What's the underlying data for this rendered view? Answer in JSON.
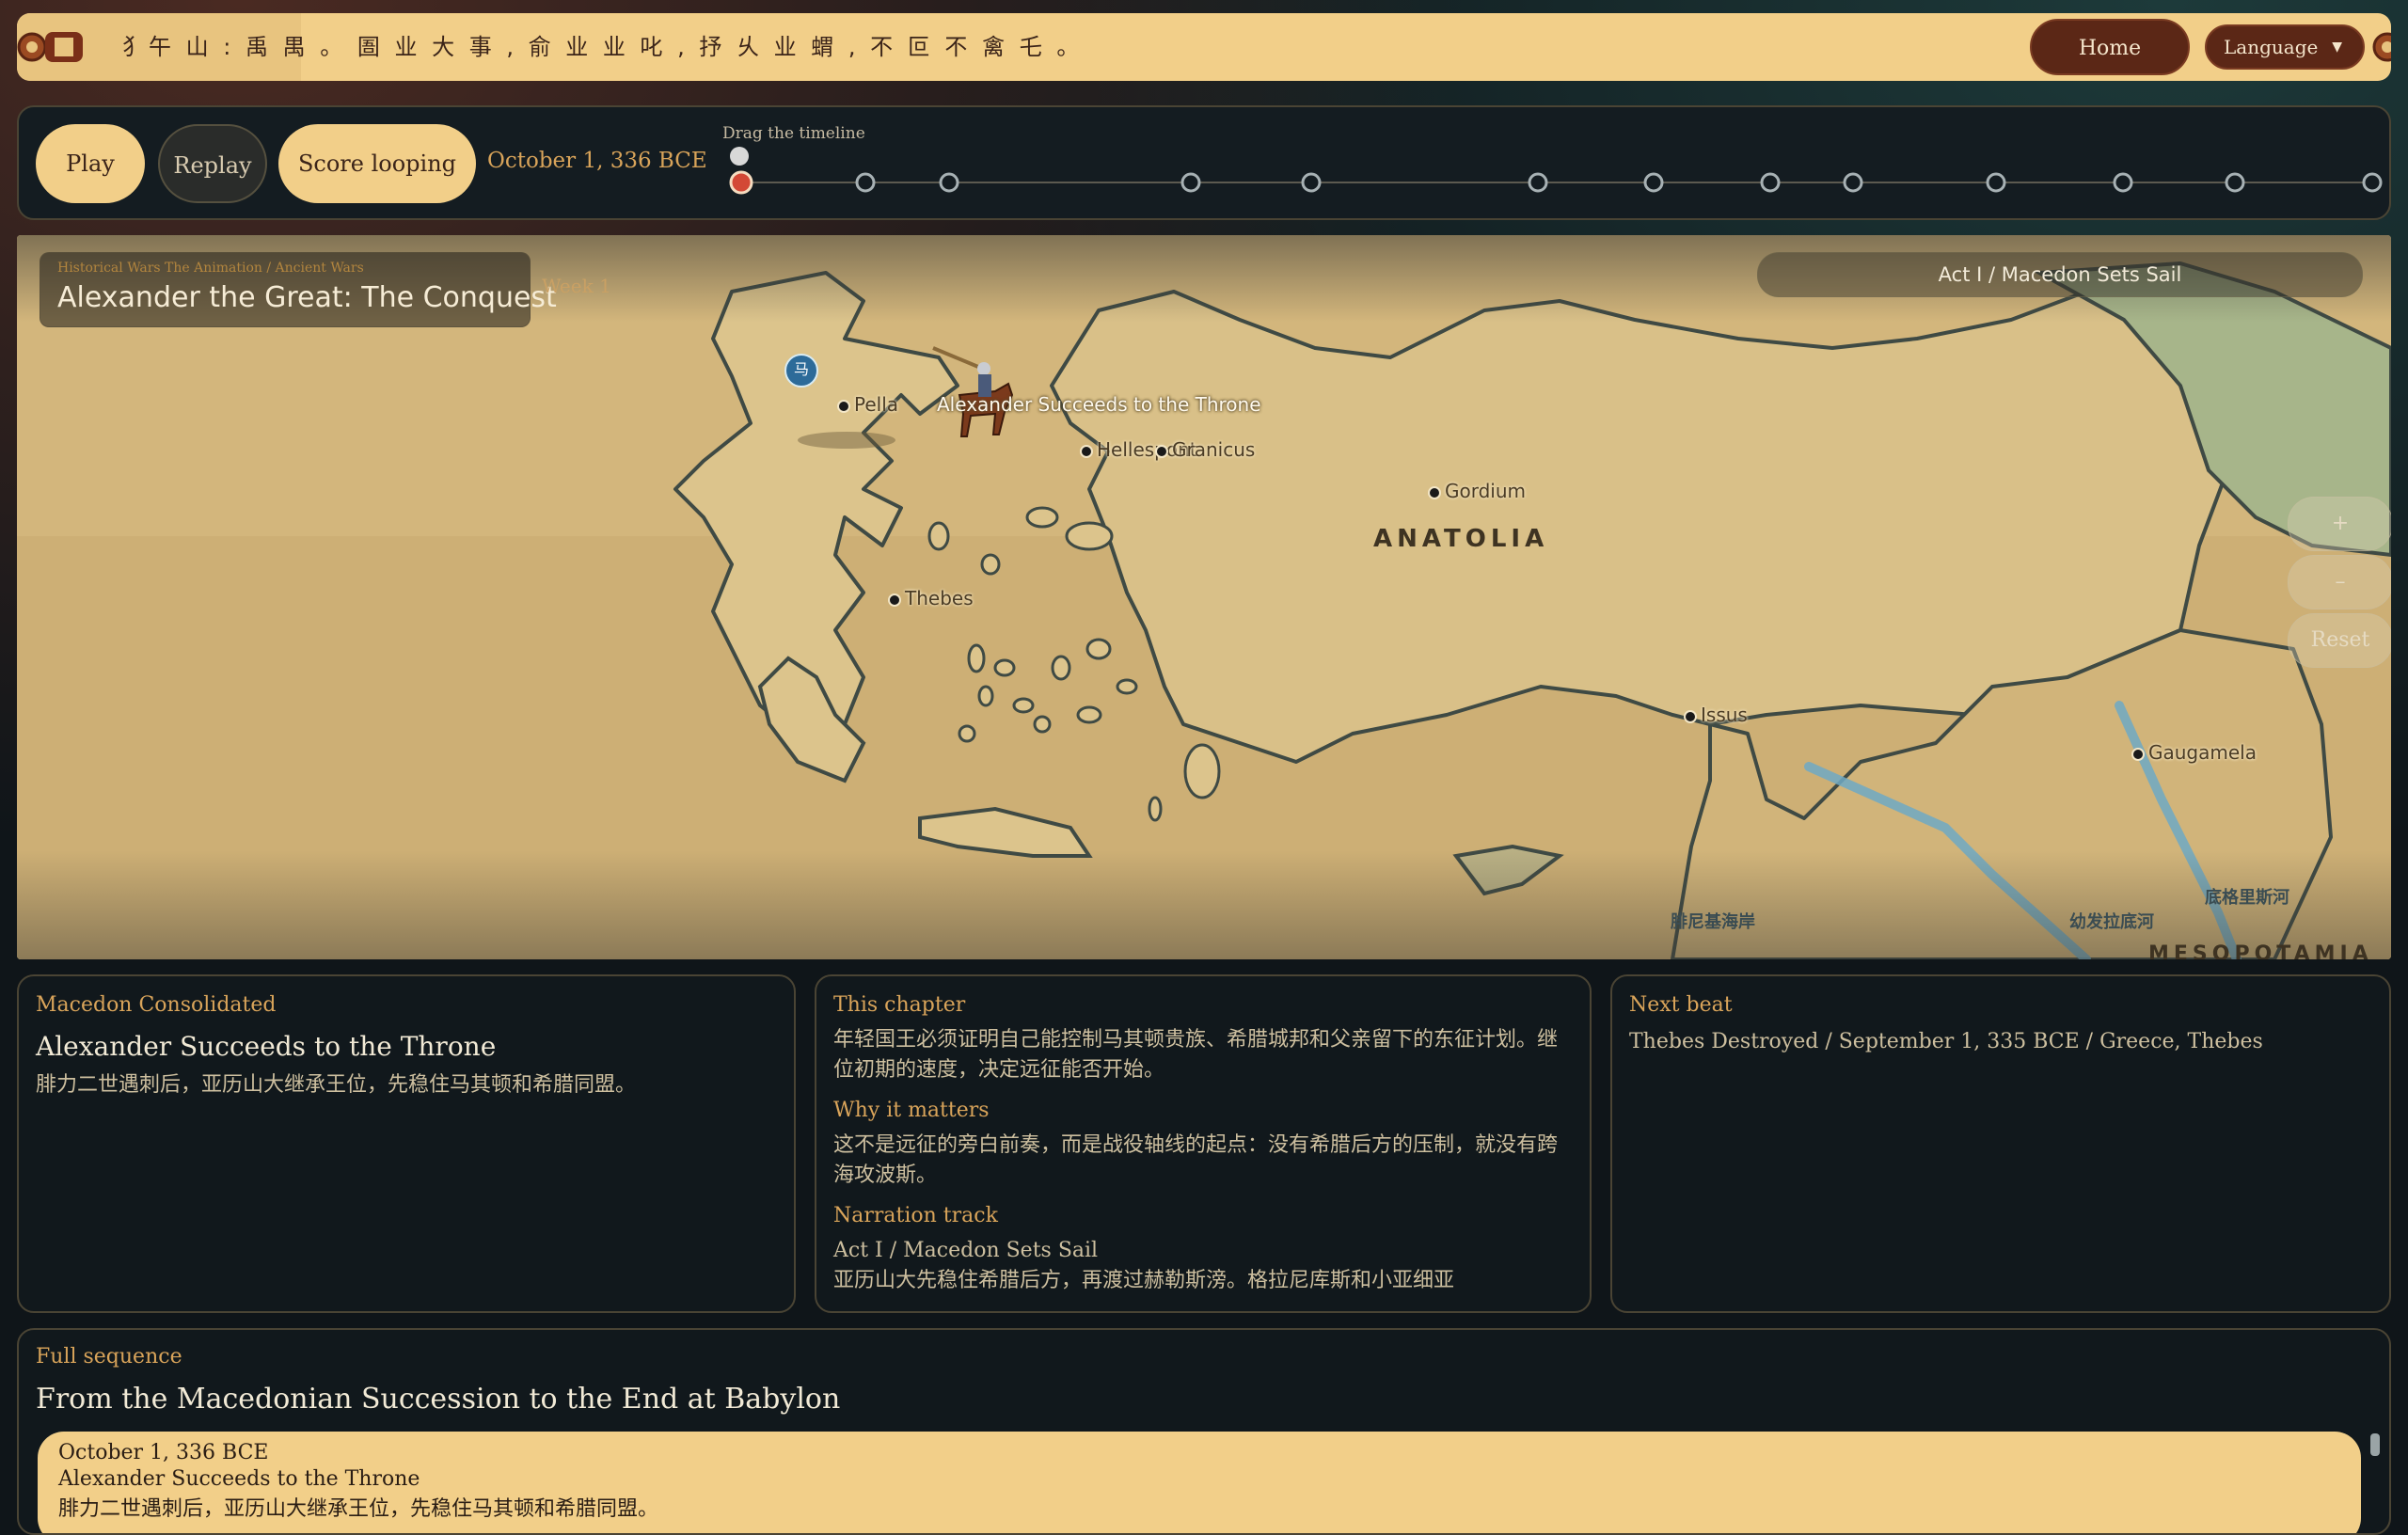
{
  "banner": {
    "script_text": "犭午 山 : 禹 禺 。 圄 业 大 事 , 俞 业 业 叱 , 抒 乆 业 蝟 , 不 叵 不 禽 乇 。",
    "home_label": "Home",
    "language_label": "Language"
  },
  "controls": {
    "play_label": "Play",
    "replay_label": "Replay",
    "loop_label": "Score looping",
    "current_date": "October 1, 336 BCE",
    "drag_hint": "Drag the timeline",
    "timeline_progress": 0.0
  },
  "map": {
    "breadcrumb": "Historical Wars The Animation / Ancient Wars",
    "title": "Alexander the Great: The Conquest",
    "week": "Week 1",
    "act": "Act I / Macedon Sets Sail",
    "zoom_in": "+",
    "zoom_out": "–",
    "reset_label": "Reset",
    "region": "ANATOLIA",
    "region2": "MESOPOTAMIA",
    "badge": "马",
    "cities": {
      "pella": "Pella",
      "event": "Alexander Succeeds to the Throne",
      "hellespont": "Hellespont",
      "granicus": "Granicus",
      "gordium": "Gordium",
      "thebes": "Thebes",
      "issus": "Issus",
      "gaugamela": "Gaugamela"
    },
    "rivers": {
      "euphrates": "幼发拉底河",
      "tigris": "底格里斯河",
      "coast": "腓尼基海岸"
    },
    "colors": {
      "land": "#d7bd83",
      "river": "#6ea9c4",
      "border": "#3f4a44"
    }
  },
  "card1": {
    "kicker": "Macedon Consolidated",
    "title": "Alexander Succeeds to the Throne",
    "body": "腓力二世遇刺后，亚历山大继承王位，先稳住马其顿和希腊同盟。"
  },
  "card2": {
    "k1": "This chapter",
    "p1": "年轻国王必须证明自己能控制马其顿贵族、希腊城邦和父亲留下的东征计划。继位初期的速度，决定远征能否开始。",
    "k2": "Why it matters",
    "p2": "这不是远征的旁白前奏，而是战役轴线的起点：没有希腊后方的压制，就没有跨海攻波斯。",
    "k3": "Narration track",
    "p3a": "Act I / Macedon Sets Sail",
    "p3b": "亚历山大先稳住希腊后方，再渡过赫勒斯滂。格拉尼库斯和小亚细亚"
  },
  "card3": {
    "kicker": "Next beat",
    "body": "Thebes Destroyed / September 1, 335 BCE / Greece, Thebes"
  },
  "sequence": {
    "kicker": "Full sequence",
    "title": "From the Macedonian Succession to the End at Babylon",
    "item_date": "October 1, 336 BCE",
    "item_title": "Alexander Succeeds to the Throne",
    "item_body": "腓力二世遇刺后，亚历山大继承王位，先稳住马其顿和希腊同盟。"
  }
}
